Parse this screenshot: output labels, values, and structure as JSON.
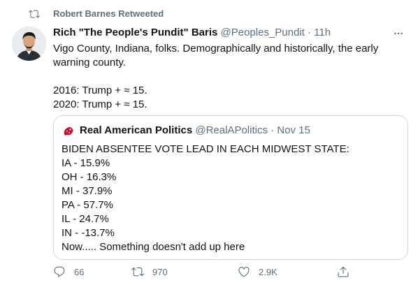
{
  "social_context": {
    "icon": "retweet-icon",
    "text": "Robert Barnes Retweeted"
  },
  "tweet": {
    "author": {
      "name": "Rich \"The People's Pundit\" Baris",
      "handle": "@Peoples_Pundit",
      "time": "11h",
      "separator": "·"
    },
    "text_lines": [
      "Vigo County, Indiana, folks. Demographically and historically, the early",
      "warning county.",
      "",
      "2016: Trump + ≈ 15.",
      "2020: Trump + ≈ 15."
    ],
    "quoted": {
      "author": {
        "name": "Real American Politics",
        "handle": "@RealAPolitics",
        "time": "Nov 15",
        "separator": "·"
      },
      "lines": [
        "BIDEN ABSENTEE VOTE LEAD IN EACH MIDWEST STATE:",
        "IA - 15.9%",
        "OH - 16.3%",
        "MI - 37.9%",
        "PA - 57.7%",
        "IL - 24.7%",
        "IN - -13.7%",
        "Now..... Something doesn't add up here"
      ]
    },
    "actions": {
      "reply_count": "66",
      "retweet_count": "970",
      "like_count": "2.9K"
    }
  },
  "colors": {
    "text_primary": "#0f1419",
    "text_secondary": "#5b7083",
    "border": "#cfd9de"
  }
}
